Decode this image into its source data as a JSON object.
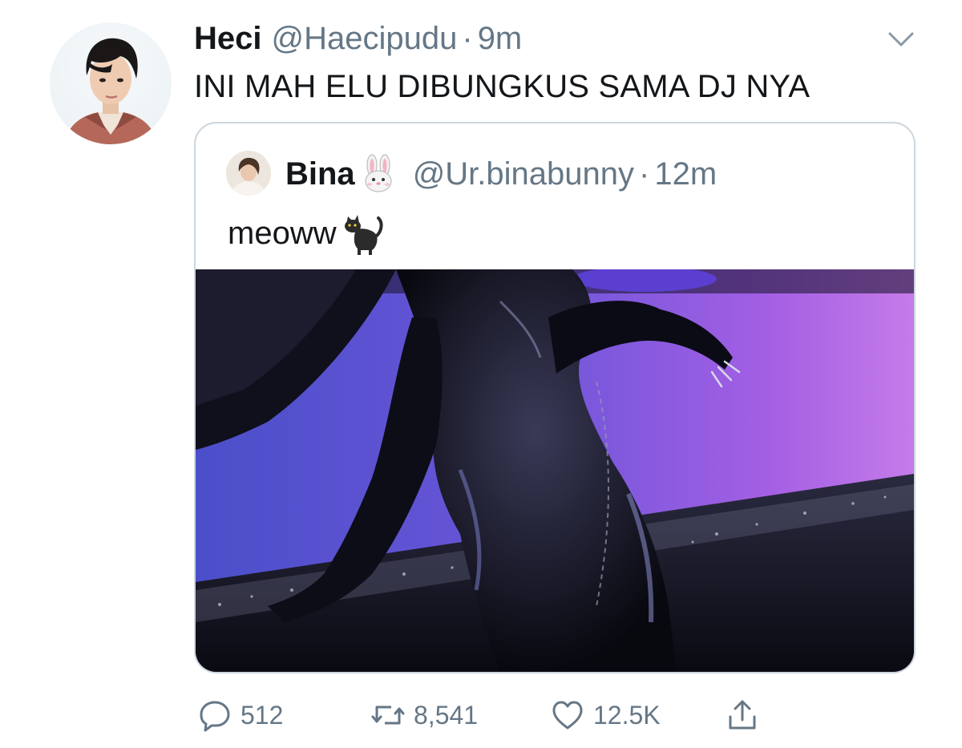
{
  "tweet": {
    "author": {
      "display_name": "Heci",
      "handle": "@Haecipudu",
      "separator": "·",
      "time": "9m",
      "avatar_icon": "profile-photo"
    },
    "text": "INI MAH ELU DIBUNGKUS SAMA DJ NYA",
    "menu_icon": "chevron-down-icon"
  },
  "quoted": {
    "author": {
      "display_name": "Bina",
      "name_emoji": "rabbit-face-emoji",
      "handle": "@Ur.binabunny",
      "separator": "·",
      "time": "12m"
    },
    "text": "meoww",
    "text_emoji": "black-cat-emoji",
    "media": {
      "description_icon": "photo",
      "palette": [
        "#6a4fd8",
        "#9a5ce6",
        "#c77be8",
        "#0b0a14"
      ]
    }
  },
  "actions": {
    "reply_count": "512",
    "retweet_count": "8,541",
    "like_count": "12.5K"
  },
  "colors": {
    "text_primary": "#14171a",
    "text_secondary": "#657786",
    "border": "#ccd6dd"
  }
}
